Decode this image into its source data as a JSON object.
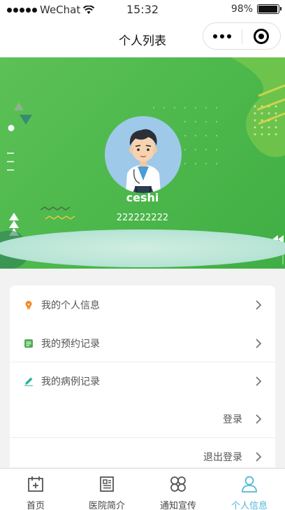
{
  "status_bar": {
    "carrier": "WeChat",
    "time": "15:32",
    "battery": "98%",
    "battery_level": 0.98
  },
  "nav": {
    "title": "个人列表"
  },
  "profile": {
    "username": "ceshi",
    "phone": "222222222"
  },
  "menu": {
    "items": [
      {
        "label": "我的个人信息",
        "icon": "lightbulb-icon",
        "color": "#f08a24"
      },
      {
        "label": "我的预约记录",
        "icon": "calendar-icon",
        "color": "#4caf50"
      },
      {
        "label": "我的病例记录",
        "icon": "pencil-icon",
        "color": "#2bb3a3"
      },
      {
        "label": "登录"
      },
      {
        "label": "退出登录"
      }
    ]
  },
  "tabbar": {
    "tabs": [
      {
        "label": "首页",
        "icon": "home-calendar-icon"
      },
      {
        "label": "医院简介",
        "icon": "newspaper-icon"
      },
      {
        "label": "通知宣传",
        "icon": "grid-circles-icon"
      },
      {
        "label": "个人信息",
        "icon": "person-icon",
        "active": true
      }
    ],
    "active_color": "#53b6d8"
  },
  "colors": {
    "banner_green": "#4db84c",
    "text_gray": "#555555"
  }
}
